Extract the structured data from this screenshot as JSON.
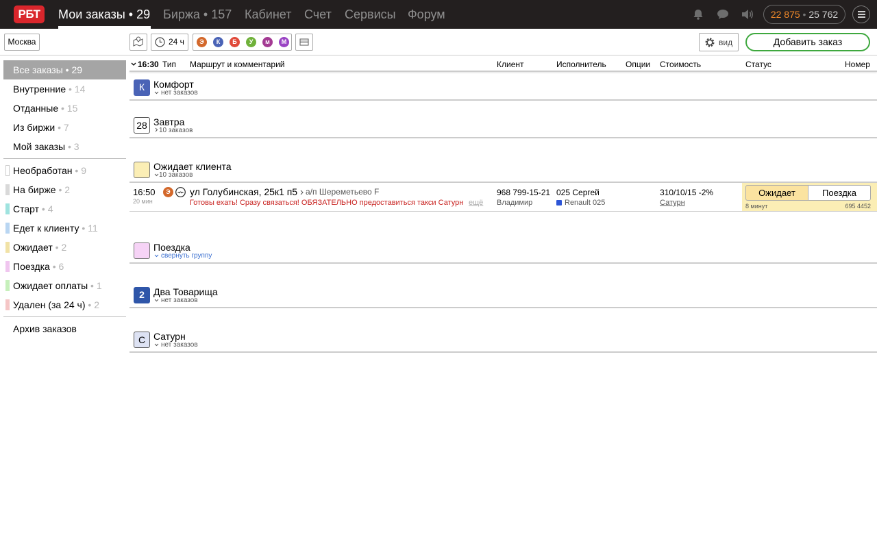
{
  "topbar": {
    "logo": "РБТ",
    "nav": [
      {
        "label": "Мои заказы • 29"
      },
      {
        "label": "Биржа • 157"
      },
      {
        "label": "Кабинет"
      },
      {
        "label": "Счет"
      },
      {
        "label": "Сервисы"
      },
      {
        "label": "Форум"
      }
    ],
    "balance_primary": "22 875",
    "balance_sep": "•",
    "balance_secondary": "25 762",
    "icons": [
      "bell-icon",
      "chat-icon",
      "speaker-icon",
      "menu-icon"
    ]
  },
  "toolbar": {
    "city": "Москва",
    "time_range": "24 ч",
    "class_filters": [
      {
        "letter": "Э",
        "color": "#d3682b"
      },
      {
        "letter": "К",
        "color": "#4a63b6"
      },
      {
        "letter": "Б",
        "color": "#e04a3a"
      },
      {
        "letter": "У",
        "color": "#6fb13a"
      },
      {
        "letter": "м",
        "color": "#a33a93"
      },
      {
        "letter": "М",
        "color": "#9a44c4"
      }
    ],
    "view_label": "вид",
    "add_order_label": "Добавить заказ"
  },
  "sidebar": {
    "primary": [
      {
        "label": "Все заказы • 29",
        "count": ""
      },
      {
        "label": "Внутренние",
        "count": " • 14"
      },
      {
        "label": "Отданные",
        "count": " • 15"
      },
      {
        "label": "Из биржи",
        "count": " • 7"
      },
      {
        "label": "Мой заказы",
        "count": " • 3"
      }
    ],
    "statuses": [
      {
        "label": "Необработан",
        "count": " • 9",
        "color": "#ffffff"
      },
      {
        "label": "На бирже",
        "count": " • 2",
        "color": "#d9d9d9"
      },
      {
        "label": "Старт",
        "count": " • 4",
        "color": "#9fe3df"
      },
      {
        "label": "Едет к клиенту",
        "count": " • 11",
        "color": "#b9d6f2"
      },
      {
        "label": "Ожидает",
        "count": " • 2",
        "color": "#f1e2a6"
      },
      {
        "label": "Поездка",
        "count": " • 6",
        "color": "#f0c6ef"
      },
      {
        "label": "Ожидает оплаты",
        "count": " • 1",
        "color": "#c6f0bb"
      },
      {
        "label": "Удален (за 24 ч)",
        "count": " • 2",
        "color": "#f5c6c6"
      }
    ],
    "archive": "Архив заказов"
  },
  "table_header": {
    "time": "16:30",
    "type": "Тип",
    "route": "Маршрут и комментарий",
    "client": "Клиент",
    "executor": "Исполнитель",
    "options": "Опции",
    "cost": "Стоимость",
    "status": "Статус",
    "number": "Номер"
  },
  "groups": [
    {
      "icon": "К",
      "title": "Комфорт",
      "sub": "нет заказов"
    },
    {
      "icon": "28",
      "title": "Завтра",
      "sub": "10 заказов"
    },
    {
      "icon": "",
      "title": "Ожидает клиента",
      "sub": "10 заказов"
    },
    {
      "icon": "",
      "title": "Поездка",
      "sub": "свернуть группу"
    },
    {
      "icon": "2",
      "title": "Два Товарища",
      "sub": "нет заказов"
    },
    {
      "icon": "С",
      "title": "Сатурн",
      "sub": "нет заказов"
    }
  ],
  "order": {
    "time": "16:50",
    "time_ago": "20 мин",
    "class_letter": "Э",
    "address_from": "ул Голубинская, 25к1 п5",
    "address_to": "а/п Шереметьево F",
    "comment": "Готовы ехать! Сразу связаться! ОБЯЗАТЕЛЬНО предоставиться такси Сатурн",
    "more": "ещё",
    "client_phone": "968 799-15-21",
    "client_name": "Владимир",
    "executor_name": "025 Сергей",
    "executor_car": "Renault 025",
    "cost": "310/10/15 -2%",
    "partner": "Сатурн",
    "status_active": "Ожидает",
    "status_next": "Поездка",
    "status_wait": "8 минут",
    "order_number": "695 4452"
  }
}
